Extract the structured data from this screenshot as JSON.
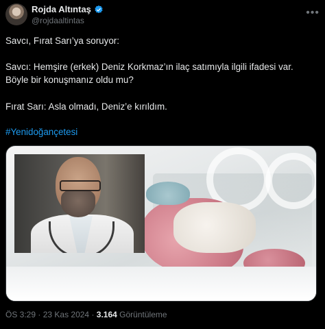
{
  "author": {
    "name": "Rojda Altıntaş",
    "handle": "@rojdaaltintas",
    "verified_color": "#1d9bf0"
  },
  "more_icon": "more-dots-icon",
  "tweet": {
    "line1": "Savcı, Fırat Sarı’ya soruyor:",
    "line2": "Savcı: Hemşire (erkek) Deniz Korkmaz’ın ilaç satımıyla ilgili ifadesi var. Böyle bir konuşmanız oldu mu?",
    "line3": "Fırat Sarı: Asla olmadı, Deniz’e kırıldım.",
    "hashtag": "#Yenidoğançetesi"
  },
  "footer": {
    "time": "ÖS 3:29",
    "separator": "·",
    "date": "23 Kas 2024",
    "views_count": "3.164",
    "views_label": "Görüntüleme"
  },
  "colors": {
    "background": "#000000",
    "text": "#e7e9ea",
    "muted": "#71767b",
    "link": "#1d9bf0"
  }
}
